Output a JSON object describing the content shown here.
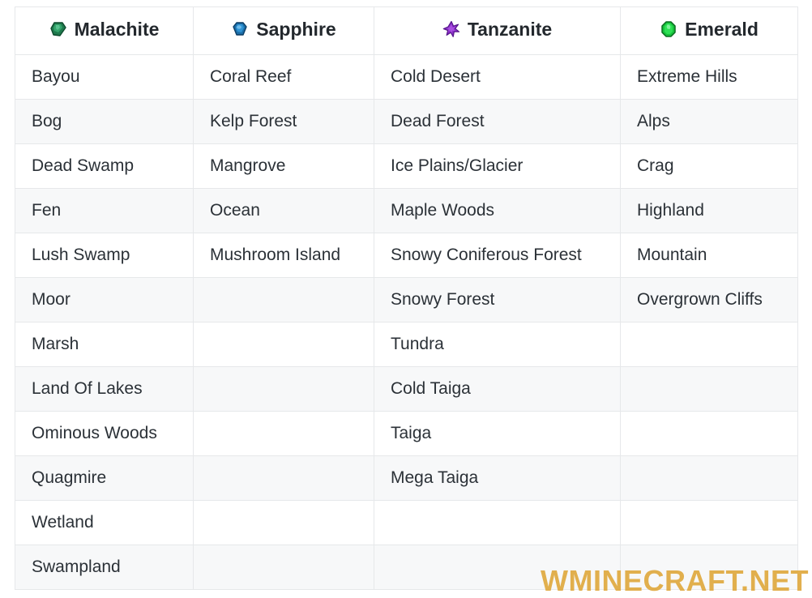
{
  "table": {
    "columns": [
      {
        "label": "Malachite",
        "icon": "malachite-gem-icon",
        "icon_color": "#1f7a4d"
      },
      {
        "label": "Sapphire",
        "icon": "sapphire-gem-icon",
        "icon_color": "#1c6ea8"
      },
      {
        "label": "Tanzanite",
        "icon": "tanzanite-gem-icon",
        "icon_color": "#8b2fc9"
      },
      {
        "label": "Emerald",
        "icon": "emerald-gem-icon",
        "icon_color": "#17c23c"
      }
    ],
    "rows": [
      [
        "Bayou",
        "Coral Reef",
        "Cold Desert",
        "Extreme Hills"
      ],
      [
        "Bog",
        "Kelp Forest",
        "Dead Forest",
        "Alps"
      ],
      [
        "Dead Swamp",
        "Mangrove",
        "Ice Plains/Glacier",
        "Crag"
      ],
      [
        "Fen",
        "Ocean",
        "Maple Woods",
        "Highland"
      ],
      [
        "Lush Swamp",
        "Mushroom Island",
        "Snowy Coniferous Forest",
        "Mountain"
      ],
      [
        "Moor",
        "",
        "Snowy Forest",
        "Overgrown Cliffs"
      ],
      [
        "Marsh",
        "",
        "Tundra",
        ""
      ],
      [
        "Land Of Lakes",
        "",
        "Cold Taiga",
        ""
      ],
      [
        "Ominous Woods",
        "",
        "Taiga",
        ""
      ],
      [
        "Quagmire",
        "",
        "Mega Taiga",
        ""
      ],
      [
        "Wetland",
        "",
        "",
        ""
      ],
      [
        "Swampland",
        "",
        "",
        ""
      ]
    ]
  },
  "watermark": {
    "text": "WMINECRAFT.NET",
    "color": "#e0a93f"
  },
  "colors": {
    "row_even_bg": "#f7f8f9",
    "row_odd_bg": "#ffffff",
    "border": "#e6e8ea",
    "text": "#2b3137"
  }
}
